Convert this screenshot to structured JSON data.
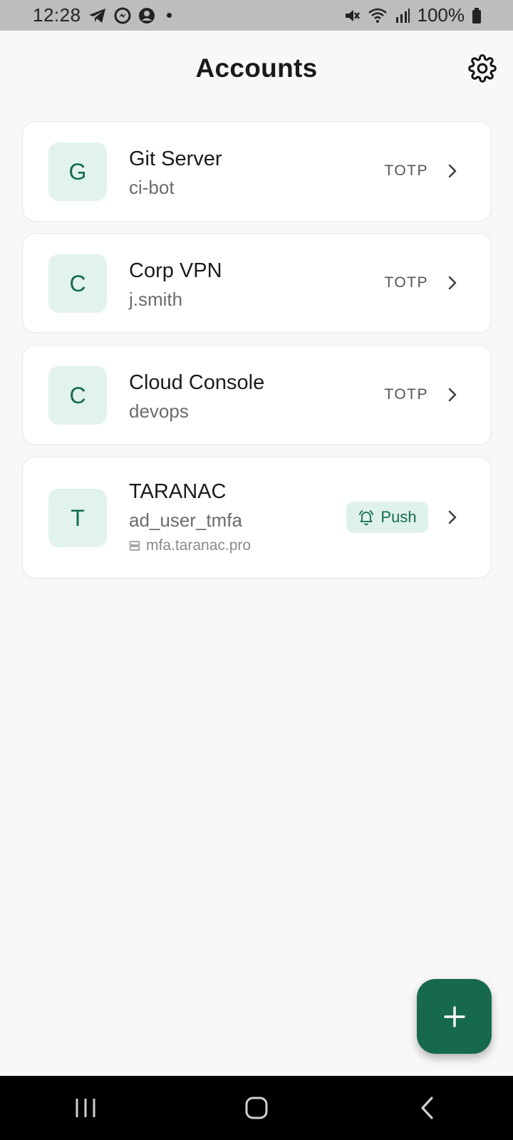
{
  "status_bar": {
    "time": "12:28",
    "battery": "100%",
    "icons_left": [
      "telegram-icon",
      "messenger-icon",
      "account-icon",
      "dot-icon"
    ],
    "icons_right": [
      "mute-icon",
      "wifi-icon",
      "signal-icon",
      "battery-icon"
    ]
  },
  "header": {
    "title": "Accounts",
    "settings_icon": "gear-icon"
  },
  "accounts": [
    {
      "initial": "G",
      "name": "Git Server",
      "user": "ci-bot",
      "type": "TOTP"
    },
    {
      "initial": "C",
      "name": "Corp VPN",
      "user": "j.smith",
      "type": "TOTP"
    },
    {
      "initial": "C",
      "name": "Cloud Console",
      "user": "devops",
      "type": "TOTP"
    },
    {
      "initial": "T",
      "name": "TARANAC",
      "user": "ad_user_tmfa",
      "server": "mfa.taranac.pro",
      "type": "Push",
      "type_icon": "bell-ring-icon",
      "server_icon": "server-icon"
    }
  ],
  "fab": {
    "icon": "plus-icon"
  },
  "nav": {
    "buttons": [
      "recents-icon",
      "home-icon",
      "back-icon"
    ]
  },
  "colors": {
    "accent": "#17694d",
    "avatar_bg": "#e1f3ec",
    "avatar_text": "#146b4c",
    "push_badge_bg": "#dff2ea",
    "background": "#f8f8f8"
  }
}
